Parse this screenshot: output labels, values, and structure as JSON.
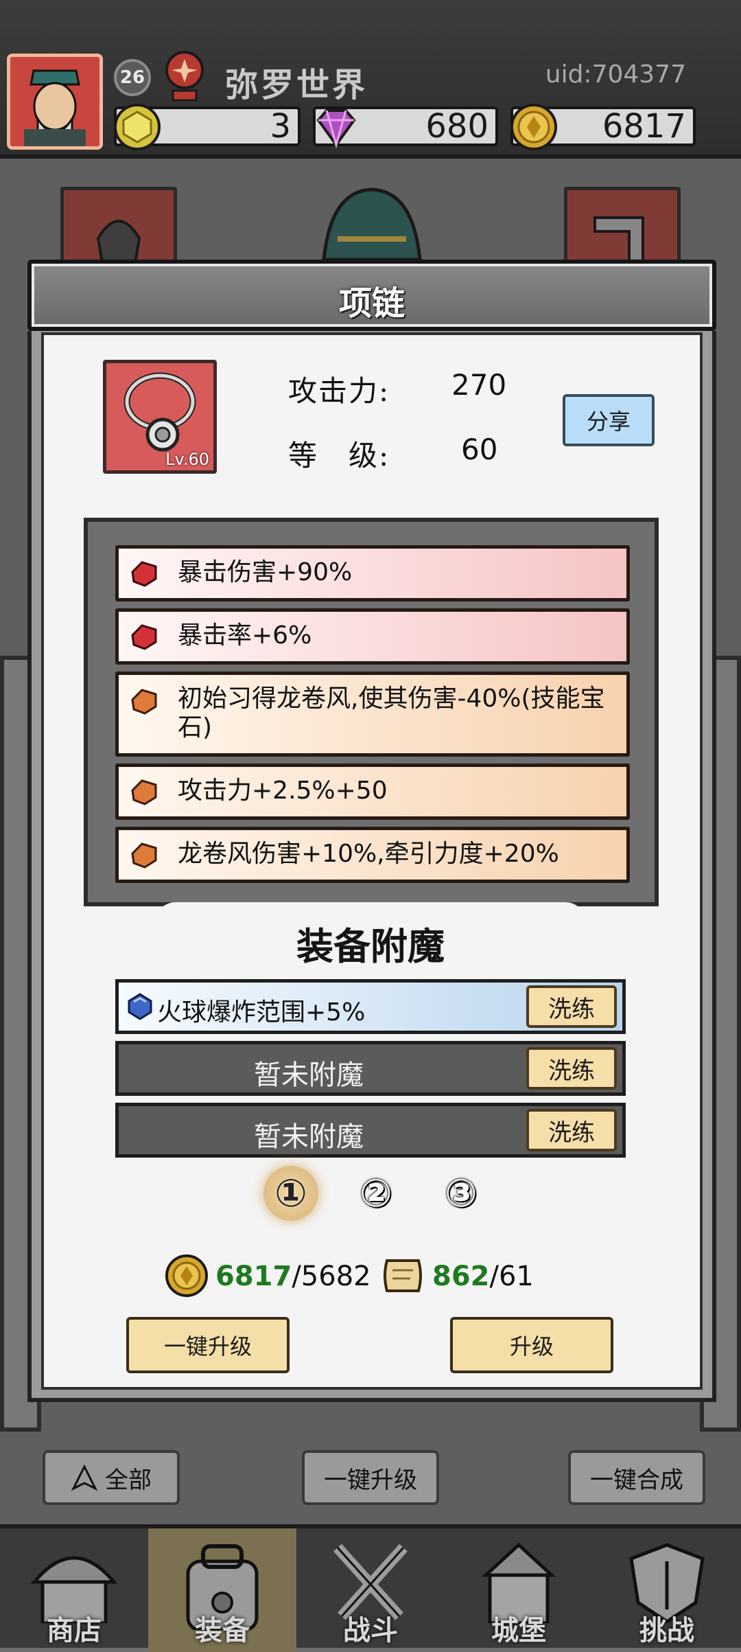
{
  "header": {
    "player_level": "26",
    "player_name": "弥罗世界",
    "uid": "uid:704377",
    "currencies": [
      {
        "icon": "yellow-gem-icon",
        "value": "3"
      },
      {
        "icon": "purple-diamond-icon",
        "value": "680"
      },
      {
        "icon": "gold-coin-icon",
        "value": "6817"
      }
    ]
  },
  "modal": {
    "title": "项链",
    "item": {
      "icon": "necklace-icon",
      "level": "Lv.60"
    },
    "stats": [
      {
        "label": "攻击力:",
        "value": "270"
      },
      {
        "label": "等　级:",
        "value": "60"
      }
    ],
    "share_label": "分享",
    "affixes": [
      {
        "icon": "red-gem-icon",
        "text": "暴击伤害+90%"
      },
      {
        "icon": "red-gem-icon",
        "text": "暴击率+6%"
      },
      {
        "icon": "orange-gem-icon",
        "text": "初始习得龙卷风,使其伤害-40%(技能宝石)"
      },
      {
        "icon": "orange-gem-icon",
        "text": "攻击力+2.5%+50"
      },
      {
        "icon": "orange-gem-icon",
        "text": "龙卷风伤害+10%,牵引力度+20%"
      }
    ],
    "enchant": {
      "title": "装备附魔",
      "rows": [
        {
          "icon": "blue-gem-icon",
          "text": "火球爆炸范围+5%",
          "button": "洗练"
        },
        {
          "text": "暂未附魔",
          "button": "洗练"
        },
        {
          "text": "暂未附魔",
          "button": "洗练"
        }
      ],
      "pages": [
        "①",
        "②",
        "③"
      ],
      "selected_page": "①"
    },
    "costs": [
      {
        "icon": "gold-coin-icon",
        "have": "6817",
        "need": "/5682"
      },
      {
        "icon": "scroll-icon",
        "have": "862",
        "need": "/61"
      }
    ],
    "buttons": {
      "upgrade_all": "一键升级",
      "upgrade": "升级"
    }
  },
  "toolbar": {
    "filter_all": "全部",
    "upgrade_all": "一键升级",
    "merge_all": "一键合成"
  },
  "nav": [
    {
      "icon": "shop-icon",
      "label": "商店"
    },
    {
      "icon": "backpack-icon",
      "label": "装备",
      "active": true
    },
    {
      "icon": "crossed-swords-icon",
      "label": "战斗"
    },
    {
      "icon": "castle-icon",
      "label": "城堡"
    },
    {
      "icon": "shield-icon",
      "label": "挑战"
    }
  ],
  "colors": {
    "header_bg": "#353535",
    "item_quality": "#d65b5a",
    "button_gold": "#f5dea8",
    "share_blue": "#b9ddf6",
    "have_green": "#1f7a1f"
  }
}
